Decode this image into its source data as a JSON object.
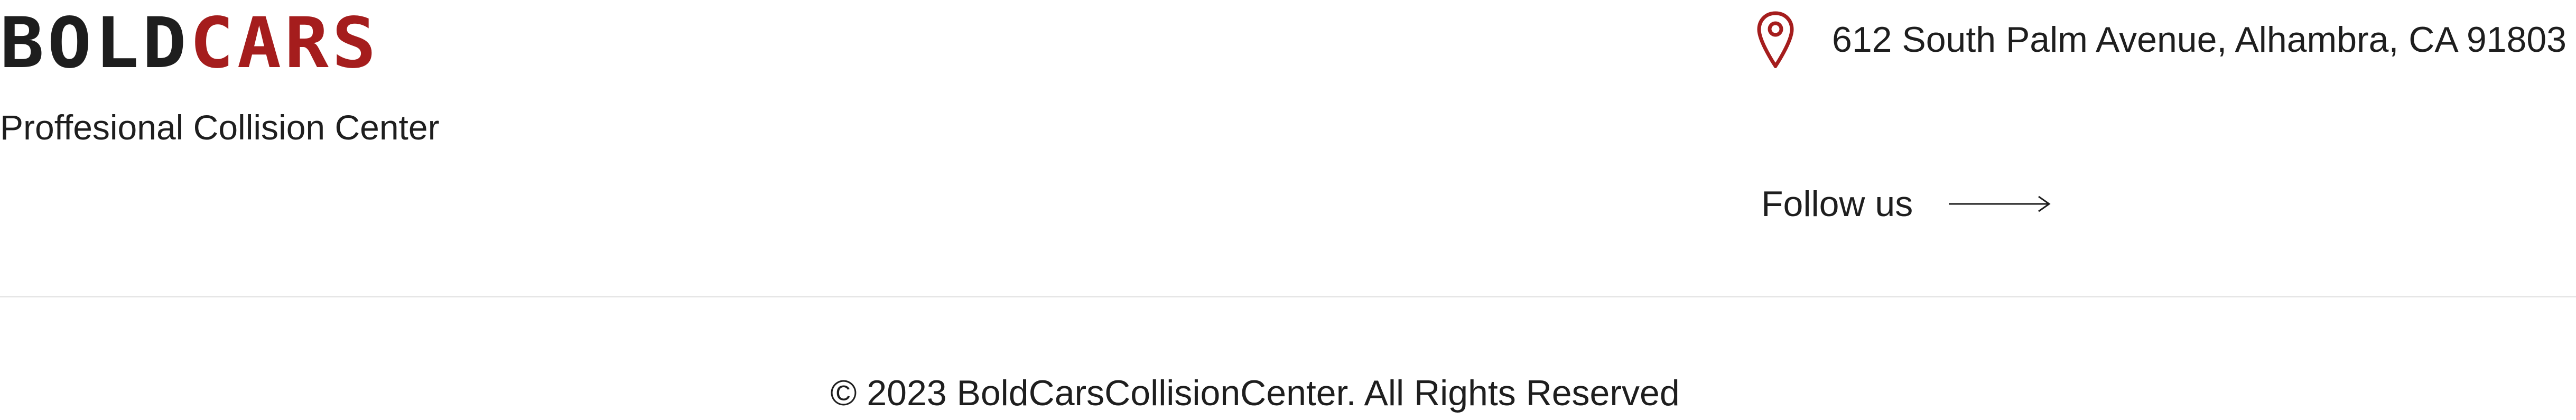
{
  "logo": {
    "part1": "BOLD",
    "part2": "CARS",
    "part1_color": "#1e1e1e",
    "part2_color": "#a51d1d"
  },
  "tagline": "Proffesional Collision Center",
  "contact": {
    "address_icon": "location-pin-icon",
    "address": "612 South Palm Avenue, Alhambra, CA 91803"
  },
  "social": {
    "follow_label": "Follow us",
    "arrow_icon": "arrow-right-icon"
  },
  "footer": {
    "copyright": "© 2023 BoldCarsCollisionCenter. All Rights Reserved"
  }
}
